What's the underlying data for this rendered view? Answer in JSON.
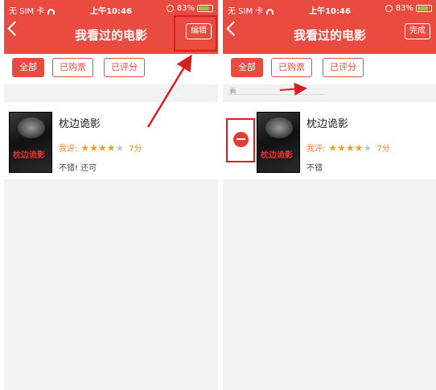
{
  "status": {
    "carrier": "无 SIM 卡",
    "time": "上午10:46",
    "battery": "83%"
  },
  "screens": [
    {
      "nav": {
        "title": "我看过的电影",
        "action_label": "编辑"
      },
      "filters": [
        "全部",
        "已购票",
        "已评分"
      ],
      "section_label": "",
      "movie": {
        "title": "枕边诡影",
        "rating_label": "我评:",
        "stars_filled": 3.5,
        "score": "7分",
        "review": "不错! 还可",
        "poster_text": "枕边诡影"
      }
    },
    {
      "nav": {
        "title": "我看过的电影",
        "action_label": "完成"
      },
      "filters": [
        "全部",
        "已购票",
        "已评分"
      ],
      "section_label": "看",
      "movie": {
        "title": "枕边诡影",
        "rating_label": "我评:",
        "stars_filled": 3.5,
        "score": "7分",
        "review": "不错",
        "poster_text": "枕边诡影"
      }
    }
  ],
  "colors": {
    "accent": "#e94b40",
    "star": "#f0a020",
    "annotation": "#d62020"
  }
}
